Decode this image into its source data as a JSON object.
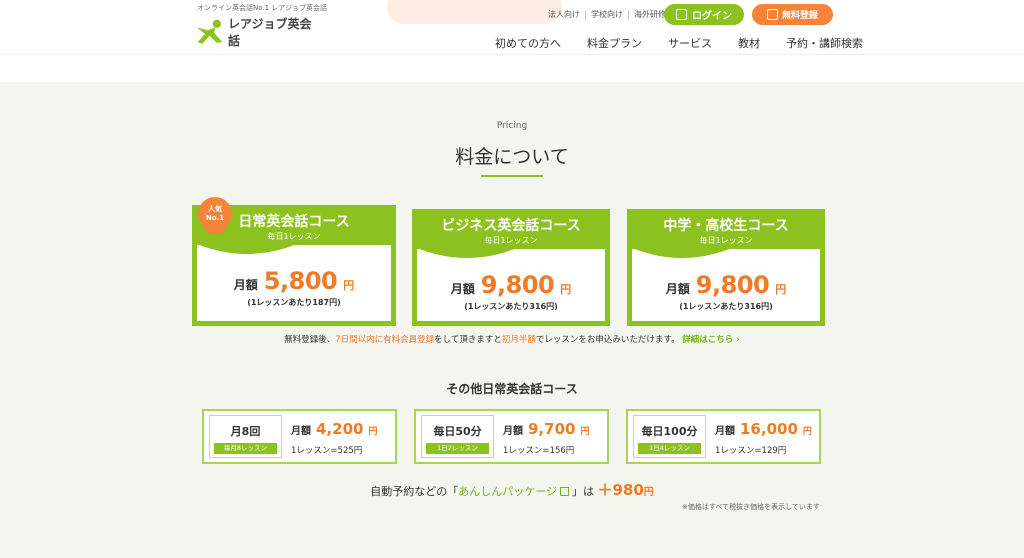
{
  "header": {
    "tagline": "オンライン英会話No.1 レアジョブ英会話",
    "logo_text": "レアジョブ英会話",
    "top_links": [
      "法人向け",
      "学校向け",
      "海外研修"
    ],
    "login_label": "ログイン",
    "register_label": "無料登録",
    "nav": [
      "初めての方へ",
      "料金プラン",
      "サービス",
      "教材",
      "予約・講師検索"
    ]
  },
  "pricing": {
    "eyebrow": "Pricing",
    "title": "料金について",
    "badge_line1": "人気",
    "badge_line2": "No.1",
    "cards": [
      {
        "title": "日常英会話コース",
        "sub": "毎日1レッスン",
        "label": "月額",
        "price": "5,800",
        "unit": "円",
        "per": "(1レッスンあたり187円)"
      },
      {
        "title": "ビジネス英会話コース",
        "sub": "毎日1レッスン",
        "label": "月額",
        "price": "9,800",
        "unit": "円",
        "per": "(1レッスンあたり316円)"
      },
      {
        "title": "中学・高校生コース",
        "sub": "毎日1レッスン",
        "label": "月額",
        "price": "9,800",
        "unit": "円",
        "per": "(1レッスンあたり316円)"
      }
    ],
    "note": {
      "part1": "無料登録後、",
      "highlight1": "7日間以内に有料会員登録",
      "part2": "をして頂きますと",
      "highlight2": "初月半額",
      "part3": "でレッスンをお申込みいただけます。",
      "link": "詳細はこちら"
    }
  },
  "other": {
    "title": "その他日常英会話コース",
    "cards": [
      {
        "box": "月8回",
        "tag": "毎月8レッスン",
        "label": "月額",
        "price": "4,200",
        "unit": "円",
        "per": "1レッスン=525円"
      },
      {
        "box": "毎日50分",
        "tag": "1日2レッスン",
        "label": "月額",
        "price": "9,700",
        "unit": "円",
        "per": "1レッスン=156円"
      },
      {
        "box": "毎日100分",
        "tag": "1日4レッスン",
        "label": "月額",
        "price": "16,000",
        "unit": "円",
        "per": "1レッスン=129円"
      }
    ]
  },
  "anshin": {
    "prefix": "自動予約などの「",
    "link": "あんしんパッケージ",
    "suffix": "」は",
    "plus": "＋980",
    "unit": "円"
  },
  "tax_note": "※価格はすべて税抜き価格を表示しています",
  "colors": {
    "brand_green": "#8cc220",
    "accent_orange": "#f07a25"
  }
}
